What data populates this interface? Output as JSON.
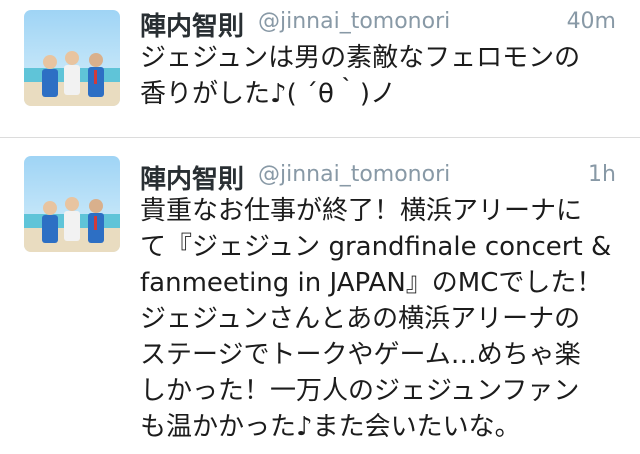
{
  "tweets": [
    {
      "display_name": "陣内智則",
      "screen_name": "@jinnai_tomonori",
      "timestamp": "40m",
      "text_lines": [
        "ジェジュンは男の素敵なフェロモンの",
        "香りがした♪( ´θ｀)ノ"
      ]
    },
    {
      "display_name": "陣内智則",
      "screen_name": "@jinnai_tomonori",
      "timestamp": "1h",
      "text_lines": [
        "貴重なお仕事が終了！横浜アリーナに",
        "て『ジェジュン grandfinale concert &",
        "fanmeeting in JAPAN』のMCでした！",
        "ジェジュンさんとあの横浜アリーナの",
        "ステージでトークやゲーム…めちゃ楽",
        "しかった！一万人のジェジュンファン",
        "も温かかった♪また会いたいな。"
      ]
    }
  ],
  "colors": {
    "name": "#292f33",
    "meta": "#8899a6",
    "text": "#1c1c1c",
    "divider": "#dcdcdc"
  }
}
